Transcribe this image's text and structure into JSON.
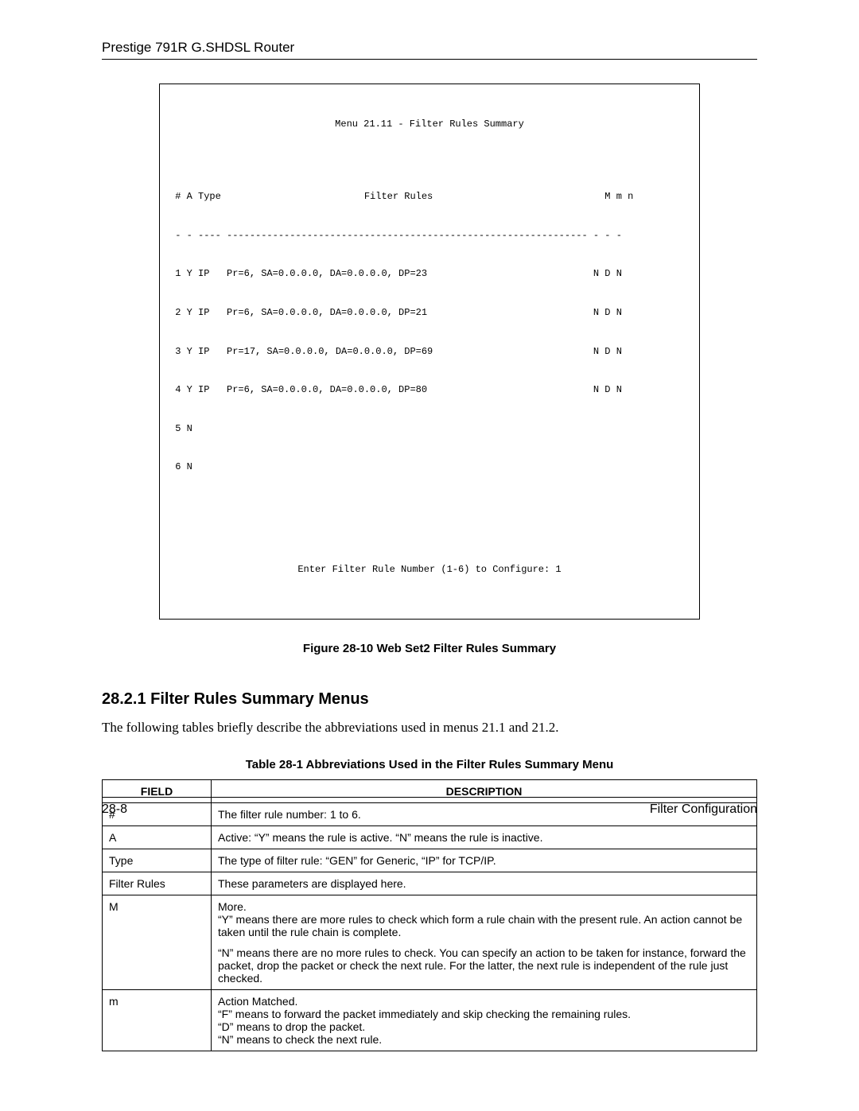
{
  "header": {
    "title": "Prestige 791R G.SHDSL Router"
  },
  "terminal": {
    "title": "Menu 21.11 - Filter Rules Summary",
    "col_header": " # A Type                         Filter Rules                              M m n",
    "col_divider": " - - ---- --------------------------------------------------------------- - - -",
    "rows": [
      " 1 Y IP   Pr=6, SA=0.0.0.0, DA=0.0.0.0, DP=23                             N D N",
      " 2 Y IP   Pr=6, SA=0.0.0.0, DA=0.0.0.0, DP=21                             N D N",
      " 3 Y IP   Pr=17, SA=0.0.0.0, DA=0.0.0.0, DP=69                            N D N",
      " 4 Y IP   Pr=6, SA=0.0.0.0, DA=0.0.0.0, DP=80                             N D N",
      " 5 N",
      " 6 N"
    ],
    "prompt": "Enter Filter Rule Number (1-6) to Configure: 1"
  },
  "figure_caption": "Figure 28-10 Web Set2 Filter Rules Summary",
  "section_heading": "28.2.1 Filter Rules Summary Menus",
  "body_paragraph": "The following tables briefly describe the abbreviations used in menus 21.1 and 21.2.",
  "table_caption": "Table 28-1 Abbreviations Used in the Filter Rules Summary Menu",
  "abbr_table": {
    "headers": {
      "field": "FIELD",
      "desc": "DESCRIPTION"
    },
    "rows": [
      {
        "field": "#",
        "desc": "The filter rule number: 1 to 6."
      },
      {
        "field": "A",
        "desc": "Active: “Y” means the rule is active. “N” means the rule is inactive."
      },
      {
        "field": "Type",
        "desc": "The type of filter rule: “GEN” for Generic, “IP” for TCP/IP."
      },
      {
        "field": "Filter Rules",
        "desc": "These parameters are displayed here."
      },
      {
        "field": "M",
        "desc1": "More.\n“Y” means there are more rules to check which form a rule chain with the present rule. An action cannot be taken until the rule chain is complete.",
        "desc2": "“N” means there are no more rules to check. You can specify an action to be taken for instance, forward the packet, drop the packet or check the next rule. For the latter, the next rule is independent of the rule just checked."
      },
      {
        "field": "m",
        "desc": "Action Matched.\n“F” means to forward the packet immediately and skip checking the remaining rules.\n“D” means to drop the packet.\n“N” means to check the next rule."
      }
    ]
  },
  "footer": {
    "left": "28-8",
    "right": "Filter Configuration"
  }
}
